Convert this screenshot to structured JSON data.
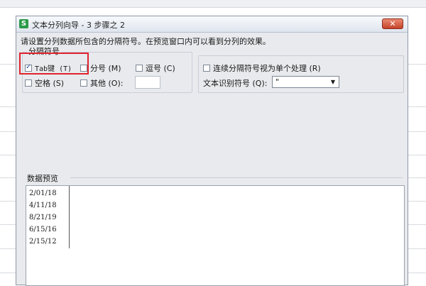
{
  "dialog": {
    "title": "文本分列向导 - 3 步骤之 2",
    "app_icon_glyph": "S",
    "close_glyph": "✕",
    "instruction": "请设置分列数据所包含的分隔符号。在预览窗口内可以看到分列的效果。"
  },
  "delimiters": {
    "legend": "分隔符号",
    "tab": {
      "label": "Tab键 (T)",
      "checked": true
    },
    "semicolon": {
      "label": "分号 (M)",
      "checked": false
    },
    "comma": {
      "label": "逗号 (C)",
      "checked": false
    },
    "space": {
      "label": "空格 (S)",
      "checked": false
    },
    "other": {
      "label": "其他 (O):",
      "checked": false,
      "value": ""
    }
  },
  "options": {
    "consecutive": {
      "label": "连续分隔符号视为单个处理 (R)",
      "checked": false
    },
    "text_qualifier_label": "文本识别符号 (Q):",
    "text_qualifier_value": "\""
  },
  "preview": {
    "label": "数据预览",
    "rows": [
      "2/01/18",
      "4/11/18",
      "8/21/19",
      "6/15/16",
      "2/15/12"
    ]
  },
  "colors": {
    "highlight": "#e0242f",
    "close_button": "#c5432a",
    "app_icon": "#2c9a49"
  }
}
